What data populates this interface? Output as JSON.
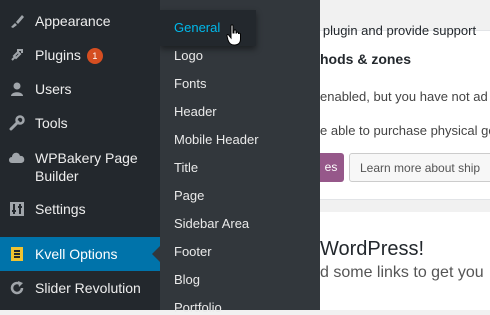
{
  "sidebar": {
    "items": [
      {
        "label": "Appearance",
        "icon": "paintbrush-icon"
      },
      {
        "label": "Plugins",
        "icon": "plugin-icon",
        "badge": "1"
      },
      {
        "label": "Users",
        "icon": "users-icon"
      },
      {
        "label": "Tools",
        "icon": "wrench-icon"
      },
      {
        "label_line1": "WPBakery Page",
        "label_line2": "Builder",
        "icon": "cloud-icon"
      },
      {
        "label": "Settings",
        "icon": "sliders-icon"
      },
      {
        "label": "Kvell Options",
        "icon": "kvell-logo-icon",
        "active": true
      },
      {
        "label": "Slider Revolution",
        "icon": "refresh-icon"
      }
    ]
  },
  "submenu": {
    "items": [
      "General",
      "Logo",
      "Fonts",
      "Header",
      "Mobile Header",
      "Title",
      "Page",
      "Sidebar Area",
      "Footer",
      "Blog",
      "Portfolio"
    ],
    "hovered": "General"
  },
  "content": {
    "top_text": "Help me develop the plugin and provide support",
    "heading": "hods & zones",
    "line1": "enabled, but you have not ad",
    "line2": "e able to purchase physical go",
    "btn_purple": "es",
    "btn_ship": "Learn more about ship",
    "wp_title": "WordPress!",
    "wp_sub": "d some links to get you"
  },
  "colors": {
    "sidebar_bg": "#23282d",
    "flyout_bg": "#32373c",
    "active_bg": "#0073aa",
    "hover_text": "#00b9eb",
    "badge_bg": "#d54e21",
    "woo_purple": "#96588a"
  }
}
